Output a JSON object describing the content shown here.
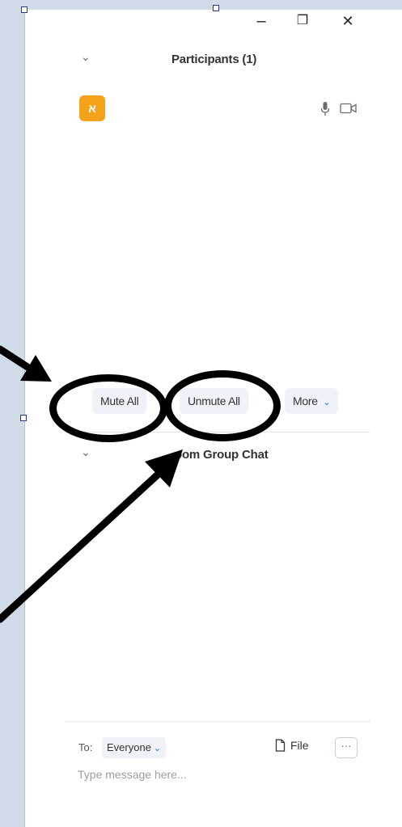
{
  "window": {
    "minimize_label": "–",
    "restore_label": "❐",
    "close_label": "✕"
  },
  "participants": {
    "chevron": "⌄",
    "title": "Participants (1)",
    "items": [
      {
        "avatar_initial": "א",
        "avatar_color": "#f5a21a",
        "mic_icon": "mic-icon",
        "video_icon": "video-icon"
      }
    ],
    "buttons": {
      "mute_all": "Mute All",
      "unmute_all": "Unmute All",
      "more": "More"
    }
  },
  "chat": {
    "chevron": "⌄",
    "title": "oom Group Chat",
    "to_label": "To:",
    "to_value": "Everyone",
    "file_label": "File",
    "more_label": "···",
    "placeholder": "Type message here..."
  },
  "colors": {
    "background": "#cfdbe6",
    "panel": "#ffffff",
    "button_bg": "#f0f2f9",
    "accent": "#1a73e8",
    "annotation": "#000000"
  }
}
